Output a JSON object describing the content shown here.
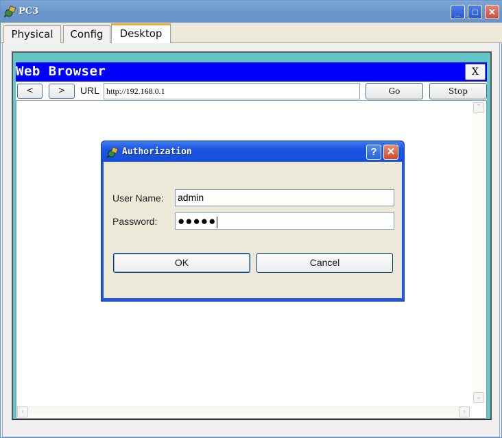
{
  "window": {
    "title": "PC3",
    "controls": {
      "minimize": "_",
      "maximize": "□",
      "close": "✕"
    }
  },
  "tabs": [
    {
      "label": "Physical",
      "active": false
    },
    {
      "label": "Config",
      "active": false
    },
    {
      "label": "Desktop",
      "active": true
    }
  ],
  "browser": {
    "title": "Web Browser",
    "close_label": "X",
    "back_label": "<",
    "forward_label": ">",
    "url_label": "URL",
    "url_value": "http://192.168.0.1",
    "go_label": "Go",
    "stop_label": "Stop",
    "scroll_up": "⌃",
    "scroll_down": "⌄",
    "scroll_left": "‹",
    "scroll_right": "›"
  },
  "dialog": {
    "title": "Authorization",
    "help_label": "?",
    "close_label": "✕",
    "username_label": "User Name:",
    "username_value": "admin",
    "password_label": "Password:",
    "password_mask": "●●●●●",
    "ok_label": "OK",
    "cancel_label": "Cancel"
  },
  "colors": {
    "browser_titlebar": "#0000ff",
    "desktop_frame": "#62c6c6",
    "dialog_titlebar": "#1f55e0",
    "active_tab_accent": "#f2a633"
  }
}
